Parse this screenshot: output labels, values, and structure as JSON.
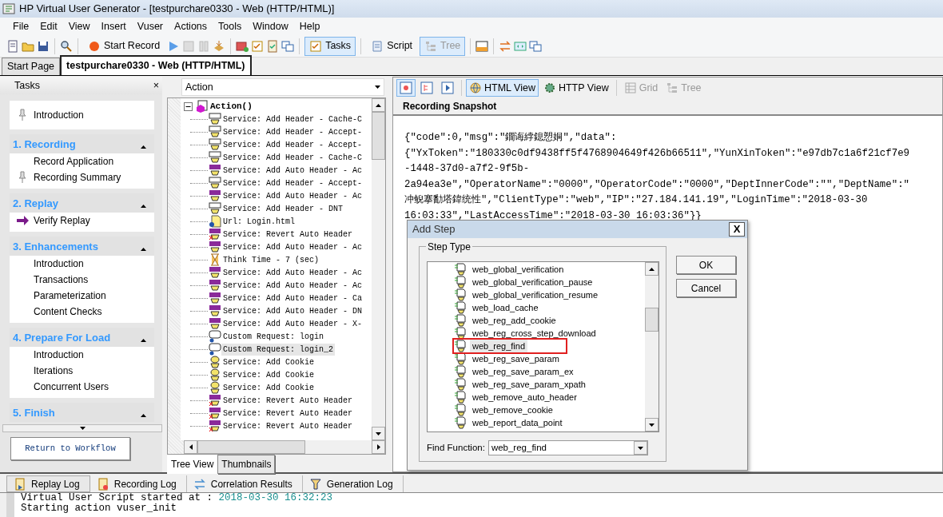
{
  "window": {
    "title": "HP Virtual User Generator - [testpurchare0330 - Web (HTTP/HTML)]"
  },
  "menu": [
    "File",
    "Edit",
    "View",
    "Insert",
    "Vuser",
    "Actions",
    "Tools",
    "Window",
    "Help"
  ],
  "toolbar": [
    {
      "label": "Start Record",
      "pressed": false,
      "disabled": false
    },
    {
      "label": "Tasks",
      "pressed": true,
      "disabled": false
    },
    {
      "label": "Script",
      "pressed": false,
      "disabled": false
    },
    {
      "label": "Tree",
      "pressed": true,
      "disabled": true
    }
  ],
  "doc_tabs": [
    {
      "label": "Start Page",
      "selected": false
    },
    {
      "label": "testpurchare0330 - Web (HTTP/HTML)",
      "selected": true
    }
  ],
  "tasks": {
    "title": "Tasks",
    "close": "×",
    "intro": {
      "label": "Introduction",
      "kind": "pinned"
    },
    "sections": [
      {
        "title": "1. Recording",
        "expanded": true,
        "items": [
          {
            "label": "Record Application",
            "kind": "plain"
          },
          {
            "label": "Recording Summary",
            "kind": "pinned"
          }
        ]
      },
      {
        "title": "2. Replay",
        "expanded": true,
        "items": [
          {
            "label": "Verify Replay",
            "kind": "current"
          }
        ]
      },
      {
        "title": "3. Enhancements",
        "expanded": true,
        "items": [
          {
            "label": "Introduction",
            "kind": "plain"
          },
          {
            "label": "Transactions",
            "kind": "plain"
          },
          {
            "label": "Parameterization",
            "kind": "plain"
          },
          {
            "label": "Content Checks",
            "kind": "plain"
          }
        ]
      },
      {
        "title": "4. Prepare For Load",
        "expanded": true,
        "items": [
          {
            "label": "Introduction",
            "kind": "plain"
          },
          {
            "label": "Iterations",
            "kind": "plain"
          },
          {
            "label": "Concurrent Users",
            "kind": "plain"
          }
        ]
      },
      {
        "title": "5. Finish",
        "expanded": true
      }
    ],
    "return_button": "Return to Workflow"
  },
  "action_select": {
    "value": "Action"
  },
  "tree": {
    "root": {
      "label": "Action()",
      "expanded": true
    },
    "children": [
      {
        "kind": "header",
        "label": "Service: Add Header - Cache-C",
        "selected": false
      },
      {
        "kind": "header",
        "label": "Service: Add Header - Accept-",
        "selected": false
      },
      {
        "kind": "header",
        "label": "Service: Add Header - Accept-",
        "selected": false
      },
      {
        "kind": "header",
        "label": "Service: Add Header - Cache-C",
        "selected": false
      },
      {
        "kind": "auto_header",
        "label": "Service: Add Auto Header - Ac",
        "selected": false
      },
      {
        "kind": "header",
        "label": "Service: Add Header - Accept-",
        "selected": false
      },
      {
        "kind": "auto_header",
        "label": "Service: Add Auto Header - Ac",
        "selected": false
      },
      {
        "kind": "header",
        "label": "Service: Add Header - DNT",
        "selected": false
      },
      {
        "kind": "url",
        "label": "Url: Login.html",
        "selected": false
      },
      {
        "kind": "revert",
        "label": "Service: Revert Auto Header",
        "selected": false
      },
      {
        "kind": "auto_header",
        "label": "Service: Add Auto Header - Ac",
        "selected": false
      },
      {
        "kind": "think",
        "label": "Think Time - 7 (sec)",
        "selected": false
      },
      {
        "kind": "auto_header",
        "label": "Service: Add Auto Header - Ac",
        "selected": false
      },
      {
        "kind": "auto_header",
        "label": "Service: Add Auto Header - Ac",
        "selected": false
      },
      {
        "kind": "auto_header",
        "label": "Service: Add Auto Header - Ca",
        "selected": false
      },
      {
        "kind": "auto_header",
        "label": "Service: Add Auto Header - DN",
        "selected": false
      },
      {
        "kind": "auto_header",
        "label": "Service: Add Auto Header - X-",
        "selected": false
      },
      {
        "kind": "custom",
        "label": "Custom Request: login",
        "selected": false
      },
      {
        "kind": "custom",
        "label": "Custom Request: login_2",
        "selected": true
      },
      {
        "kind": "cookie",
        "label": "Service: Add Cookie",
        "selected": false
      },
      {
        "kind": "cookie",
        "label": "Service: Add Cookie",
        "selected": false
      },
      {
        "kind": "cookie",
        "label": "Service: Add Cookie",
        "selected": false
      },
      {
        "kind": "revert",
        "label": "Service: Revert Auto Header",
        "selected": false
      },
      {
        "kind": "revert",
        "label": "Service: Revert Auto Header",
        "selected": false
      },
      {
        "kind": "revert",
        "label": "Service: Revert Auto Header",
        "selected": false
      }
    ],
    "tabs": [
      {
        "label": "Tree View",
        "selected": true
      },
      {
        "label": "Thumbnails",
        "selected": false
      }
    ]
  },
  "snapshot": {
    "views": [
      {
        "label": "HTML View",
        "selected": true,
        "disabled": false
      },
      {
        "label": "HTTP View",
        "selected": false,
        "disabled": false
      },
      {
        "label": "Grid",
        "selected": false,
        "disabled": true
      },
      {
        "label": "Tree",
        "selected": false,
        "disabled": true
      }
    ],
    "title": "Recording Snapshot",
    "lines": [
      "{\"code\":0,\"msg\":\"鐗诲綍鎴愬姛\",\"data\":",
      "{\"YxToken\":\"180330c0df9438ff5f4768904649f426b66511\",\"YunXinToken\":\"e97db7c1a6f21cf7e9",
      "-1448-37d0-a7f2-9f5b-",
      "2a94ea3e\",\"OperatorName\":\"0000\",\"OperatorCode\":\"0000\",\"DeptInnerCode\":\"\",\"DeptName\":\"",
      "冲鲵搴勫塔鍏统性\",\"ClientType\":\"web\",\"IP\":\"27.184.141.19\",\"LoginTime\":\"2018-03-30",
      "16:03:33\",\"LastAccessTime\":\"2018-03-30 16:03:36\"}}"
    ]
  },
  "dialog": {
    "title": "Add Step",
    "close": "X",
    "group": "Step Type",
    "items": [
      {
        "label": "web_global_verification",
        "selected": false
      },
      {
        "label": "web_global_verification_pause",
        "selected": false
      },
      {
        "label": "web_global_verification_resume",
        "selected": false
      },
      {
        "label": "web_load_cache",
        "selected": false
      },
      {
        "label": "web_reg_add_cookie",
        "selected": false
      },
      {
        "label": "web_reg_cross_step_download",
        "selected": false
      },
      {
        "label": "web_reg_find",
        "selected": true
      },
      {
        "label": "web_reg_save_param",
        "selected": false
      },
      {
        "label": "web_reg_save_param_ex",
        "selected": false
      },
      {
        "label": "web_reg_save_param_xpath",
        "selected": false
      },
      {
        "label": "web_remove_auto_header",
        "selected": false
      },
      {
        "label": "web_remove_cookie",
        "selected": false
      },
      {
        "label": "web_report_data_point",
        "selected": false
      }
    ],
    "buttons": [
      "OK",
      "Cancel"
    ],
    "find_label": "Find Function:",
    "find_value": "web_reg_find"
  },
  "log_tabs": [
    {
      "label": "Replay Log",
      "selected": true
    },
    {
      "label": "Recording Log",
      "selected": false
    },
    {
      "label": "Correlation Results",
      "selected": false
    },
    {
      "label": "Generation Log",
      "selected": false
    }
  ],
  "log_lines": [
    {
      "text": "Virtual User Script started at : ",
      "timestamp": "2018-03-30 16:32:23"
    },
    {
      "text": "Starting action vuser_init"
    }
  ]
}
